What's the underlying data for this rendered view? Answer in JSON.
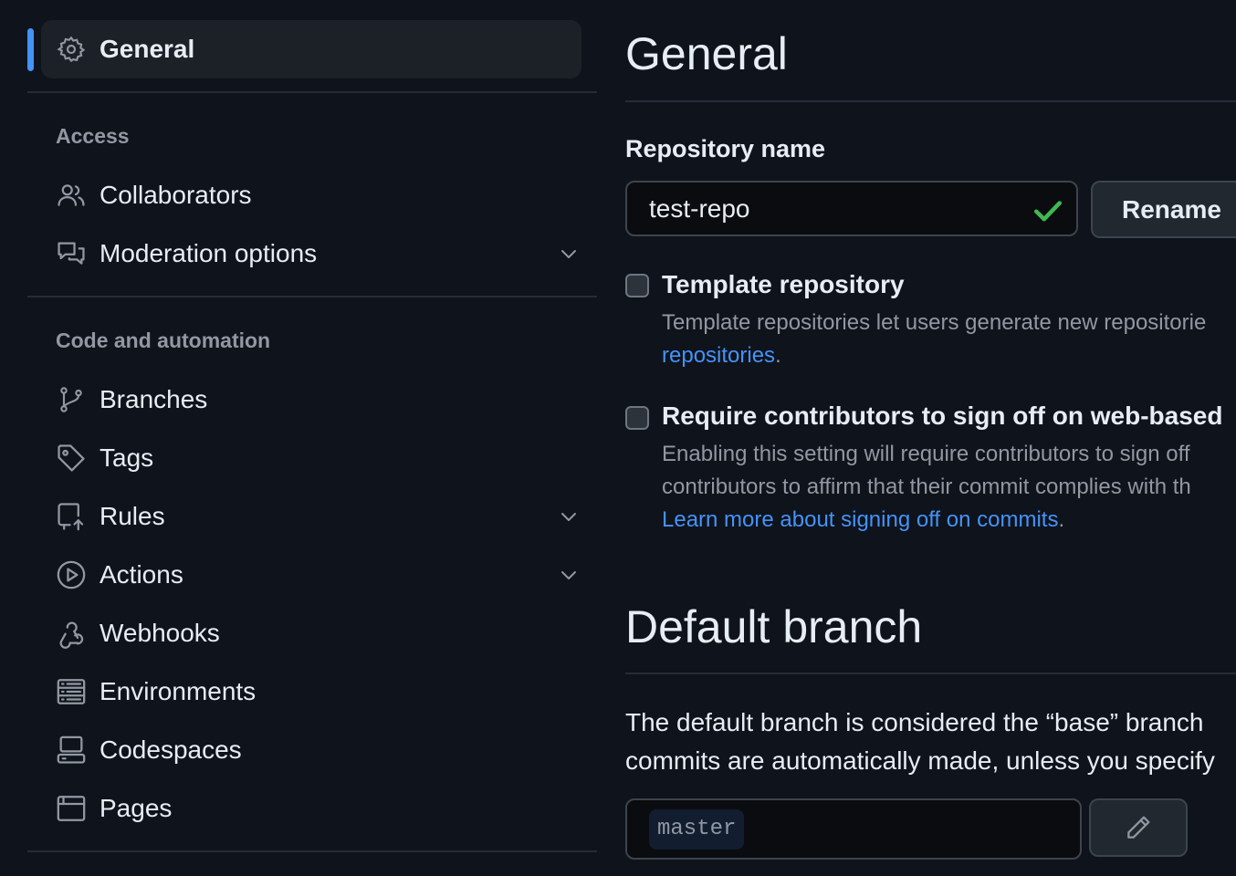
{
  "sidebar": {
    "active_item": {
      "label": "General",
      "icon": "gear-icon"
    },
    "groups": [
      {
        "heading": "Access",
        "items": [
          {
            "label": "Collaborators",
            "icon": "people-icon",
            "expandable": false
          },
          {
            "label": "Moderation options",
            "icon": "comment-discussion-icon",
            "expandable": true
          }
        ]
      },
      {
        "heading": "Code and automation",
        "items": [
          {
            "label": "Branches",
            "icon": "git-branch-icon",
            "expandable": false
          },
          {
            "label": "Tags",
            "icon": "tag-icon",
            "expandable": false
          },
          {
            "label": "Rules",
            "icon": "repo-push-icon",
            "expandable": true
          },
          {
            "label": "Actions",
            "icon": "play-icon",
            "expandable": true
          },
          {
            "label": "Webhooks",
            "icon": "webhook-icon",
            "expandable": false
          },
          {
            "label": "Environments",
            "icon": "server-icon",
            "expandable": false
          },
          {
            "label": "Codespaces",
            "icon": "codespaces-icon",
            "expandable": false
          },
          {
            "label": "Pages",
            "icon": "browser-icon",
            "expandable": false
          }
        ]
      }
    ]
  },
  "main": {
    "title": "General",
    "repo_name": {
      "label": "Repository name",
      "value": "test-repo",
      "button": "Rename"
    },
    "template": {
      "title": "Template repository",
      "desc_line1": "Template repositories let users generate new repositorie",
      "link": "repositories",
      "suffix": "."
    },
    "signoff": {
      "title": "Require contributors to sign off on web-based",
      "desc_line1": "Enabling this setting will require contributors to sign off",
      "desc_line2": "contributors to affirm that their commit complies with th",
      "link": "Learn more about signing off on commits",
      "suffix": "."
    },
    "default_branch": {
      "title": "Default branch",
      "desc_line1": "The default branch is considered the “base” branch",
      "desc_line2": "commits are automatically made, unless you specify",
      "branch": "master"
    }
  },
  "colors": {
    "background": "#0f131b",
    "accent": "#4493f8",
    "success": "#3fb950",
    "muted_text": "#9198a1"
  }
}
